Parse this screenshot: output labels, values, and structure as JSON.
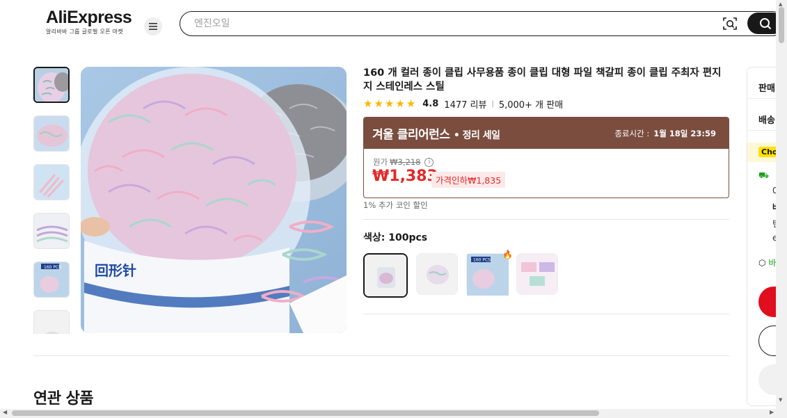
{
  "header": {
    "logo_text": "AliExpress",
    "logo_sub": "알리바바 그룹 글로벌 오픈 마켓",
    "search_placeholder": "엔진오일"
  },
  "product": {
    "title": "160 개 컬러 종이 클립 사무용품 종이 클립 대형 파일 책갈피 종이 클립 주최자 편지지 스테인레스 스틸",
    "rating": "4.8",
    "reviews": "1477 리뷰",
    "sold": "5,000+ 개 판매",
    "stars": 5
  },
  "sale": {
    "name": "겨울 클리어런스",
    "sub": "• 정리 세일",
    "end_label": "종료시간 :",
    "end_time": "1월 18일 23:59",
    "orig_label": "원가",
    "orig_price": "₩3,218",
    "price": "₩1,383",
    "discount": "가격인하₩1,835",
    "coin_note": "1% 추가 코인 할인",
    "accent": "#7b4d3f",
    "price_color": "#e52828"
  },
  "variant": {
    "label": "색상: 100pcs"
  },
  "related": {
    "title": "연관 상품"
  },
  "right_panel": {
    "seller": "판매",
    "shipping": "배송",
    "choice": "Cho",
    "t1": "0",
    "t2": "바",
    "t3": "턴",
    "t4": "e",
    "box": "바"
  }
}
